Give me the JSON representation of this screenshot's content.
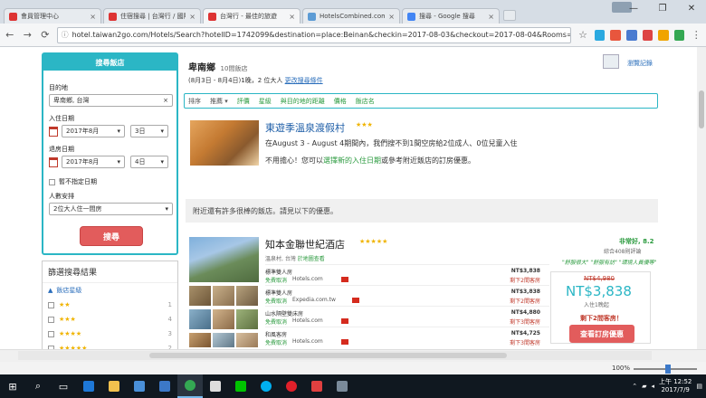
{
  "browser": {
    "tabs": [
      {
        "label": "會員管理中心",
        "color": "#d33"
      },
      {
        "label": "住宿搜尋 | 台灣行 / 國際",
        "color": "#d33"
      },
      {
        "label": "台灣行 - 最佳的旅遊",
        "color": "#d33",
        "active": true
      },
      {
        "label": "HotelsCombined.com",
        "color": "#5b9bd5"
      },
      {
        "label": "搜尋 - Google 搜尋",
        "color": "#4285f4"
      }
    ],
    "url": "hotel.taiwan2go.com/Hotels/Search?hotelID=1742099&destination=place:Beinan&checkin=2017-08-03&checkout=2017-08-04&Rooms=1&adults_1",
    "window_controls": [
      "—",
      "❐",
      "✕"
    ]
  },
  "search_form": {
    "title": "搜尋飯店",
    "destination_label": "目的地",
    "destination_value": "卑南鄉, 台灣",
    "checkin_label": "入住日期",
    "checkin_month": "2017年8月",
    "checkin_day": "3日",
    "checkout_label": "退房日期",
    "checkout_month": "2017年8月",
    "checkout_day": "4日",
    "no_date_label": "暫不指定日期",
    "guests_label": "人數安排",
    "guests_value": "2位大人住一間房",
    "search_button": "搜尋"
  },
  "filter": {
    "title": "篩選搜尋結果",
    "group_label": "飯店星級",
    "rows": [
      {
        "stars": "★★",
        "count": "1"
      },
      {
        "stars": "★★★",
        "count": "4"
      },
      {
        "stars": "★★★★",
        "count": "3"
      },
      {
        "stars": "★★★★★",
        "count": "2"
      }
    ]
  },
  "results_header": {
    "location": "卑南鄉",
    "count": "10間飯店",
    "dates": "(8月3日 - 8月4日)1晚，2 位大人",
    "change_link": "更改搜尋條件",
    "saved_label": "瀏覽記錄"
  },
  "sortbar": {
    "label": "排序",
    "options": [
      "評價",
      "星級",
      "與目的地的距離",
      "價格",
      "飯店名"
    ],
    "recommend": "推薦 ▾"
  },
  "hotel1": {
    "name": "東遊季溫泉渡假村",
    "stars": "★★★",
    "line1": "在August 3 - August 4期間內，我們搜不到1間空房給2位成人、0位兒童入住",
    "line2_pre": "不用擔心！您可以",
    "line2_link": "選擇新的入住日期",
    "line2_post": "或參考附近飯店的訂房優惠。"
  },
  "suggest_text": "附近還有許多很棒的飯店。請見以下的優惠。",
  "hotel2": {
    "name": "知本金聯世紀酒店",
    "stars": "★★★★★",
    "address": "溫泉村, 台灣",
    "map_link": "於地圖查看",
    "rating": "非常好, 8.2",
    "review_count": "綜合408則評論",
    "quote": "\"舒服很大\" \"舒服有訪\" \"環境人員優等\"",
    "rooms": [
      {
        "name": "標準雙人房",
        "free": "免費取消",
        "site": "Hotels.com",
        "price": "NT$3,838",
        "left": "剩下2間客房"
      },
      {
        "name": "標準雙人房",
        "free": "免費取消",
        "site": "Expedia.com.tw",
        "price": "NT$3,838",
        "left": "剩下2間客房"
      },
      {
        "name": "山水隔壁雙床房",
        "free": "免費取消",
        "site": "Hotels.com",
        "price": "NT$4,880",
        "left": "剩下3間客房"
      },
      {
        "name": "和風客房",
        "free": "免費取消",
        "site": "Hotels.com",
        "price": "NT$4,725",
        "left": "剩下3間客房"
      }
    ],
    "old_price": "NT$4,980",
    "price": "NT$3,838",
    "per_room": "入住1晚起",
    "lowest_note": "剩下2間客房！",
    "deal_button": "查看訂房優惠"
  },
  "zoom": "100%",
  "clock": {
    "time": "上午 12:52",
    "date": "2017/7/9"
  }
}
